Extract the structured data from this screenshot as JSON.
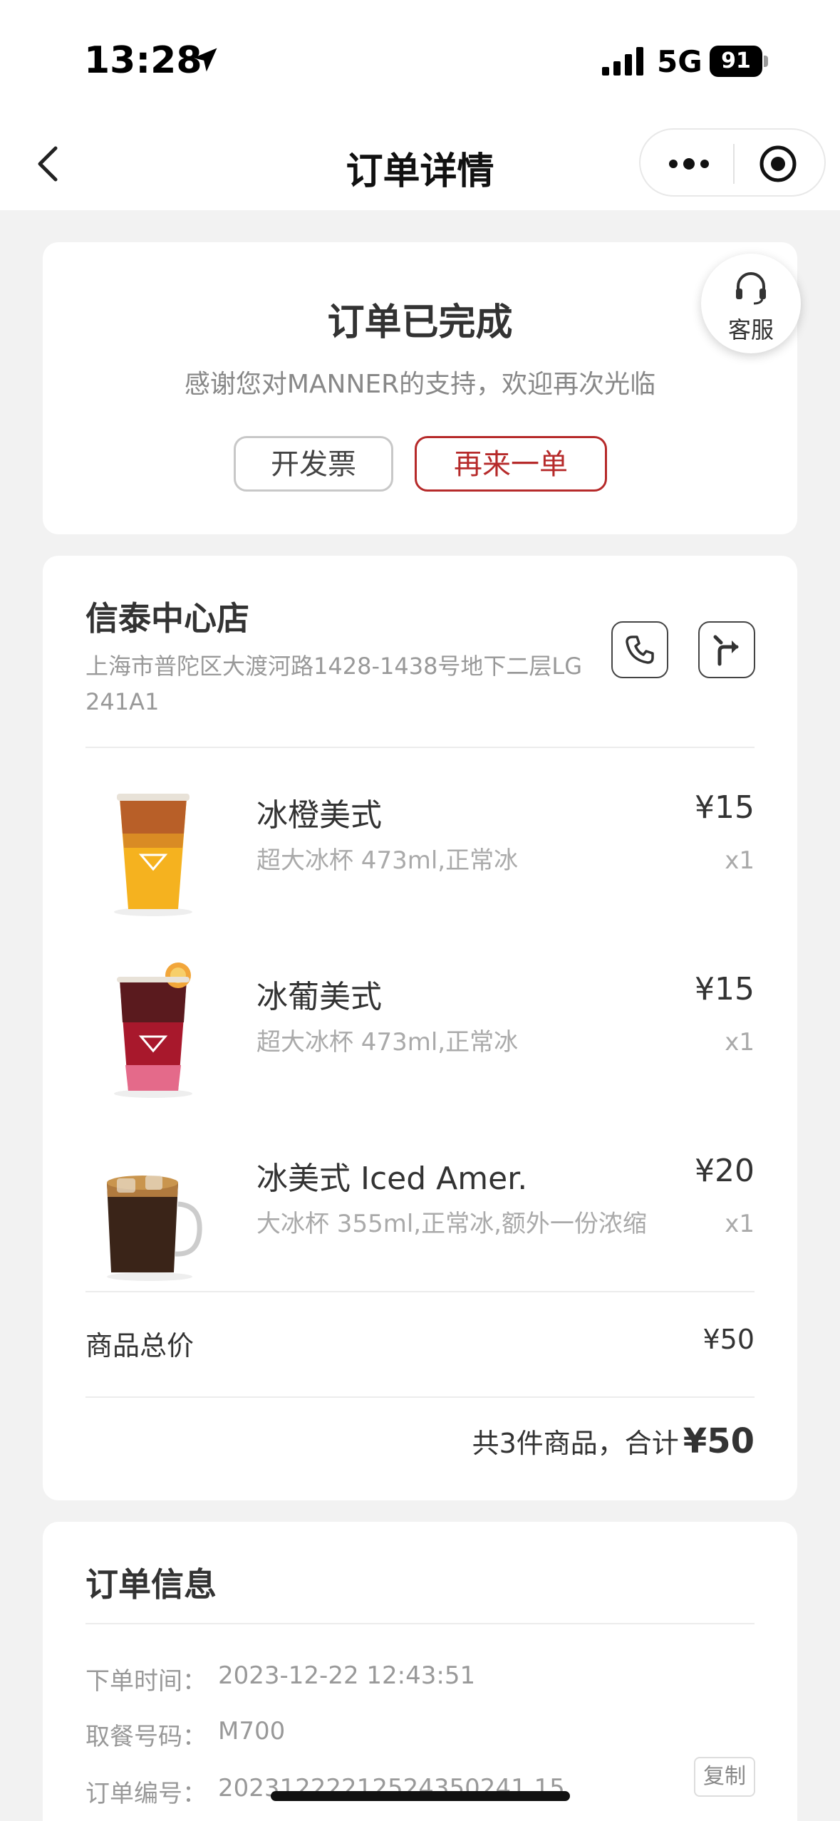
{
  "status_bar": {
    "time": "13:28",
    "network": "5G",
    "battery": "91"
  },
  "nav": {
    "title": "订单详情"
  },
  "order_status": {
    "title": "订单已完成",
    "subtitle": "感谢您对MANNER的支持，欢迎再次光临",
    "invoice_label": "开发票",
    "reorder_label": "再来一单",
    "service_label": "客服"
  },
  "store": {
    "name": "信泰中心店",
    "address": "上海市普陀区大渡河路1428-1438号地下二层LG 241A1"
  },
  "items": [
    {
      "name": "冰橙美式",
      "spec": "超大冰杯 473ml,正常冰",
      "price": "¥15",
      "qty": "x1"
    },
    {
      "name": "冰葡美式",
      "spec": "超大冰杯 473ml,正常冰",
      "price": "¥15",
      "qty": "x1"
    },
    {
      "name": "冰美式 Iced Amer.",
      "spec": "大冰杯 355ml,正常冰,额外一份浓缩",
      "price": "¥20",
      "qty": "x1"
    }
  ],
  "summary": {
    "subtotal_label": "商品总价",
    "subtotal_value": "¥50",
    "total_prefix": "共3件商品，合计",
    "total_value": "¥50"
  },
  "order_info": {
    "title": "订单信息",
    "rows": [
      {
        "key": "下单时间：",
        "value": "2023-12-22 12:43:51"
      },
      {
        "key": "取餐号码：",
        "value": "M700"
      },
      {
        "key": "订单编号：",
        "value": "20231222212524350241 15"
      }
    ],
    "copy_label": "复制"
  },
  "colors": {
    "accent": "#b62a2a",
    "background": "#f2f2f2"
  }
}
